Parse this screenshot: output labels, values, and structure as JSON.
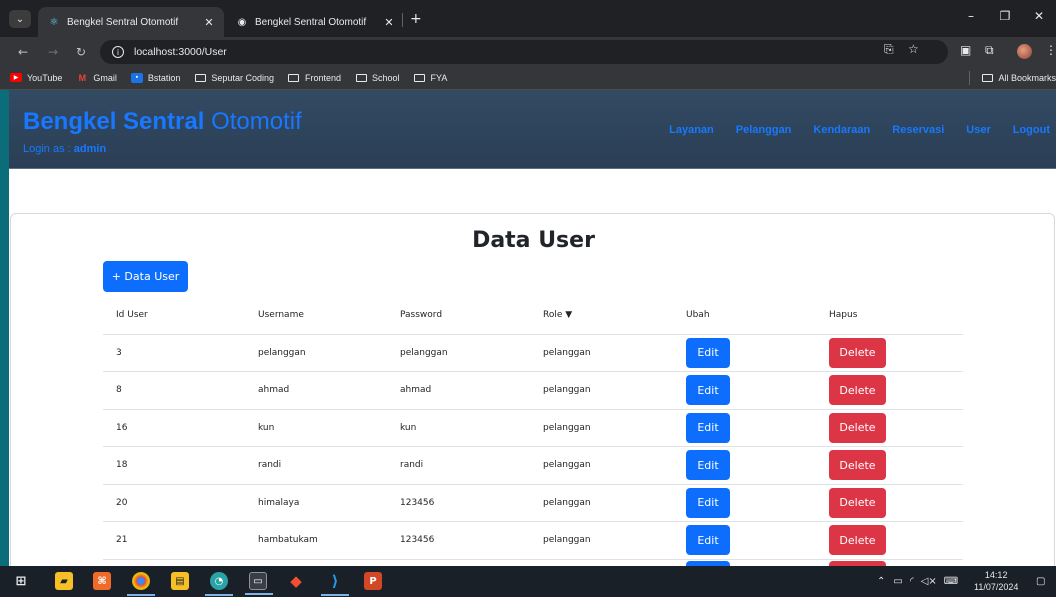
{
  "browser": {
    "tabs": [
      {
        "title": "Bengkel Sentral Otomotif",
        "active": true
      },
      {
        "title": "Bengkel Sentral Otomotif",
        "active": false
      }
    ],
    "url": "localhost:3000/User",
    "bookmarks": [
      {
        "label": "YouTube",
        "icon": "youtube-icon"
      },
      {
        "label": "Gmail",
        "icon": "gmail-icon"
      },
      {
        "label": "Bstation",
        "icon": "bstation-icon"
      },
      {
        "label": "Seputar Coding",
        "icon": "folder-icon"
      },
      {
        "label": "Frontend",
        "icon": "folder-icon"
      },
      {
        "label": "School",
        "icon": "folder-icon"
      },
      {
        "label": "FYA",
        "icon": "folder-icon"
      }
    ],
    "all_bookmarks": "All Bookmarks"
  },
  "site": {
    "brand_bold": "Bengkel Sentral",
    "brand_light": "Otomotif",
    "login_prefix": "Login as :",
    "login_user": "admin",
    "nav": [
      "Layanan",
      "Pelanggan",
      "Kendaraan",
      "Reservasi",
      "User",
      "Logout"
    ],
    "accent_color": "#1878ff"
  },
  "main": {
    "title": "Data User",
    "add_button": "+ Data User",
    "columns": [
      "Id User",
      "Username",
      "Password",
      "Role ▼",
      "Ubah",
      "Hapus"
    ],
    "edit_label": "Edit",
    "delete_label": "Delete",
    "rows": [
      {
        "id": "3",
        "username": "pelanggan",
        "password": "pelanggan",
        "role": "pelanggan"
      },
      {
        "id": "8",
        "username": "ahmad",
        "password": "ahmad",
        "role": "pelanggan"
      },
      {
        "id": "16",
        "username": "kun",
        "password": "kun",
        "role": "pelanggan"
      },
      {
        "id": "18",
        "username": "randi",
        "password": "randi",
        "role": "pelanggan"
      },
      {
        "id": "20",
        "username": "himalaya",
        "password": "123456",
        "role": "pelanggan"
      },
      {
        "id": "21",
        "username": "hambatukam",
        "password": "123456",
        "role": "pelanggan"
      }
    ]
  },
  "taskbar": {
    "time": "14:12",
    "date": "11/07/2024"
  }
}
